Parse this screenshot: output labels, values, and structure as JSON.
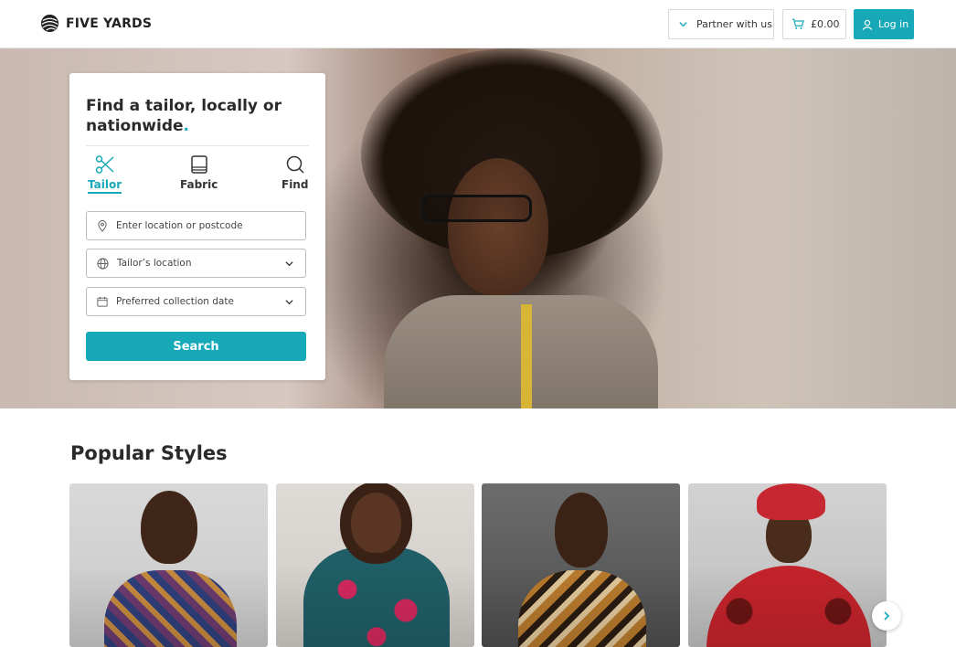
{
  "header": {
    "brand": "FIVE YARDS",
    "partner_label": "Partner with us",
    "cart_amount": "£0.00",
    "login_label": "Log in"
  },
  "search_card": {
    "title": "Find a tailor, locally or nationwide",
    "title_dot": ".",
    "tabs": [
      {
        "label": "Tailor",
        "icon": "scissors-icon",
        "active": true
      },
      {
        "label": "Fabric",
        "icon": "fabric-icon",
        "active": false
      },
      {
        "label": "Find",
        "icon": "search-icon",
        "active": false
      }
    ],
    "location_placeholder": "Enter location or postcode",
    "tailor_location": "Tailor’s location",
    "collection_date": "Preferred collection date",
    "search_label": "Search"
  },
  "popular": {
    "title": "Popular Styles"
  },
  "colors": {
    "accent": "#17a9b8",
    "text": "#2a2a2a"
  }
}
